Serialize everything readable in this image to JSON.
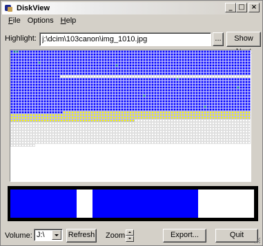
{
  "window": {
    "title": "DiskView"
  },
  "menu": {
    "items": [
      {
        "label_u": "F",
        "label_rest": "ile"
      },
      {
        "label_u": "",
        "label_rest": "Options"
      },
      {
        "label_u": "H",
        "label_rest": "elp"
      }
    ]
  },
  "highlight": {
    "label": "Highlight:",
    "value": "j:\\dcim\\103canon\\img_1010.jpg",
    "browse_label": "...",
    "show_next_label": "Show Next"
  },
  "bottom": {
    "volume_label": "Volume:",
    "volume_value": "J:\\",
    "refresh_label": "Refresh",
    "zoom_label": "Zoom:",
    "export_label": "Export...",
    "quit_label": "Quit"
  },
  "colors": {
    "used": "#0000ff",
    "highlight": "#ffff00",
    "free": "#ffffff",
    "fragment": "#008080",
    "bar_free": "#ffffff",
    "bar_used": "#0000ff"
  }
}
